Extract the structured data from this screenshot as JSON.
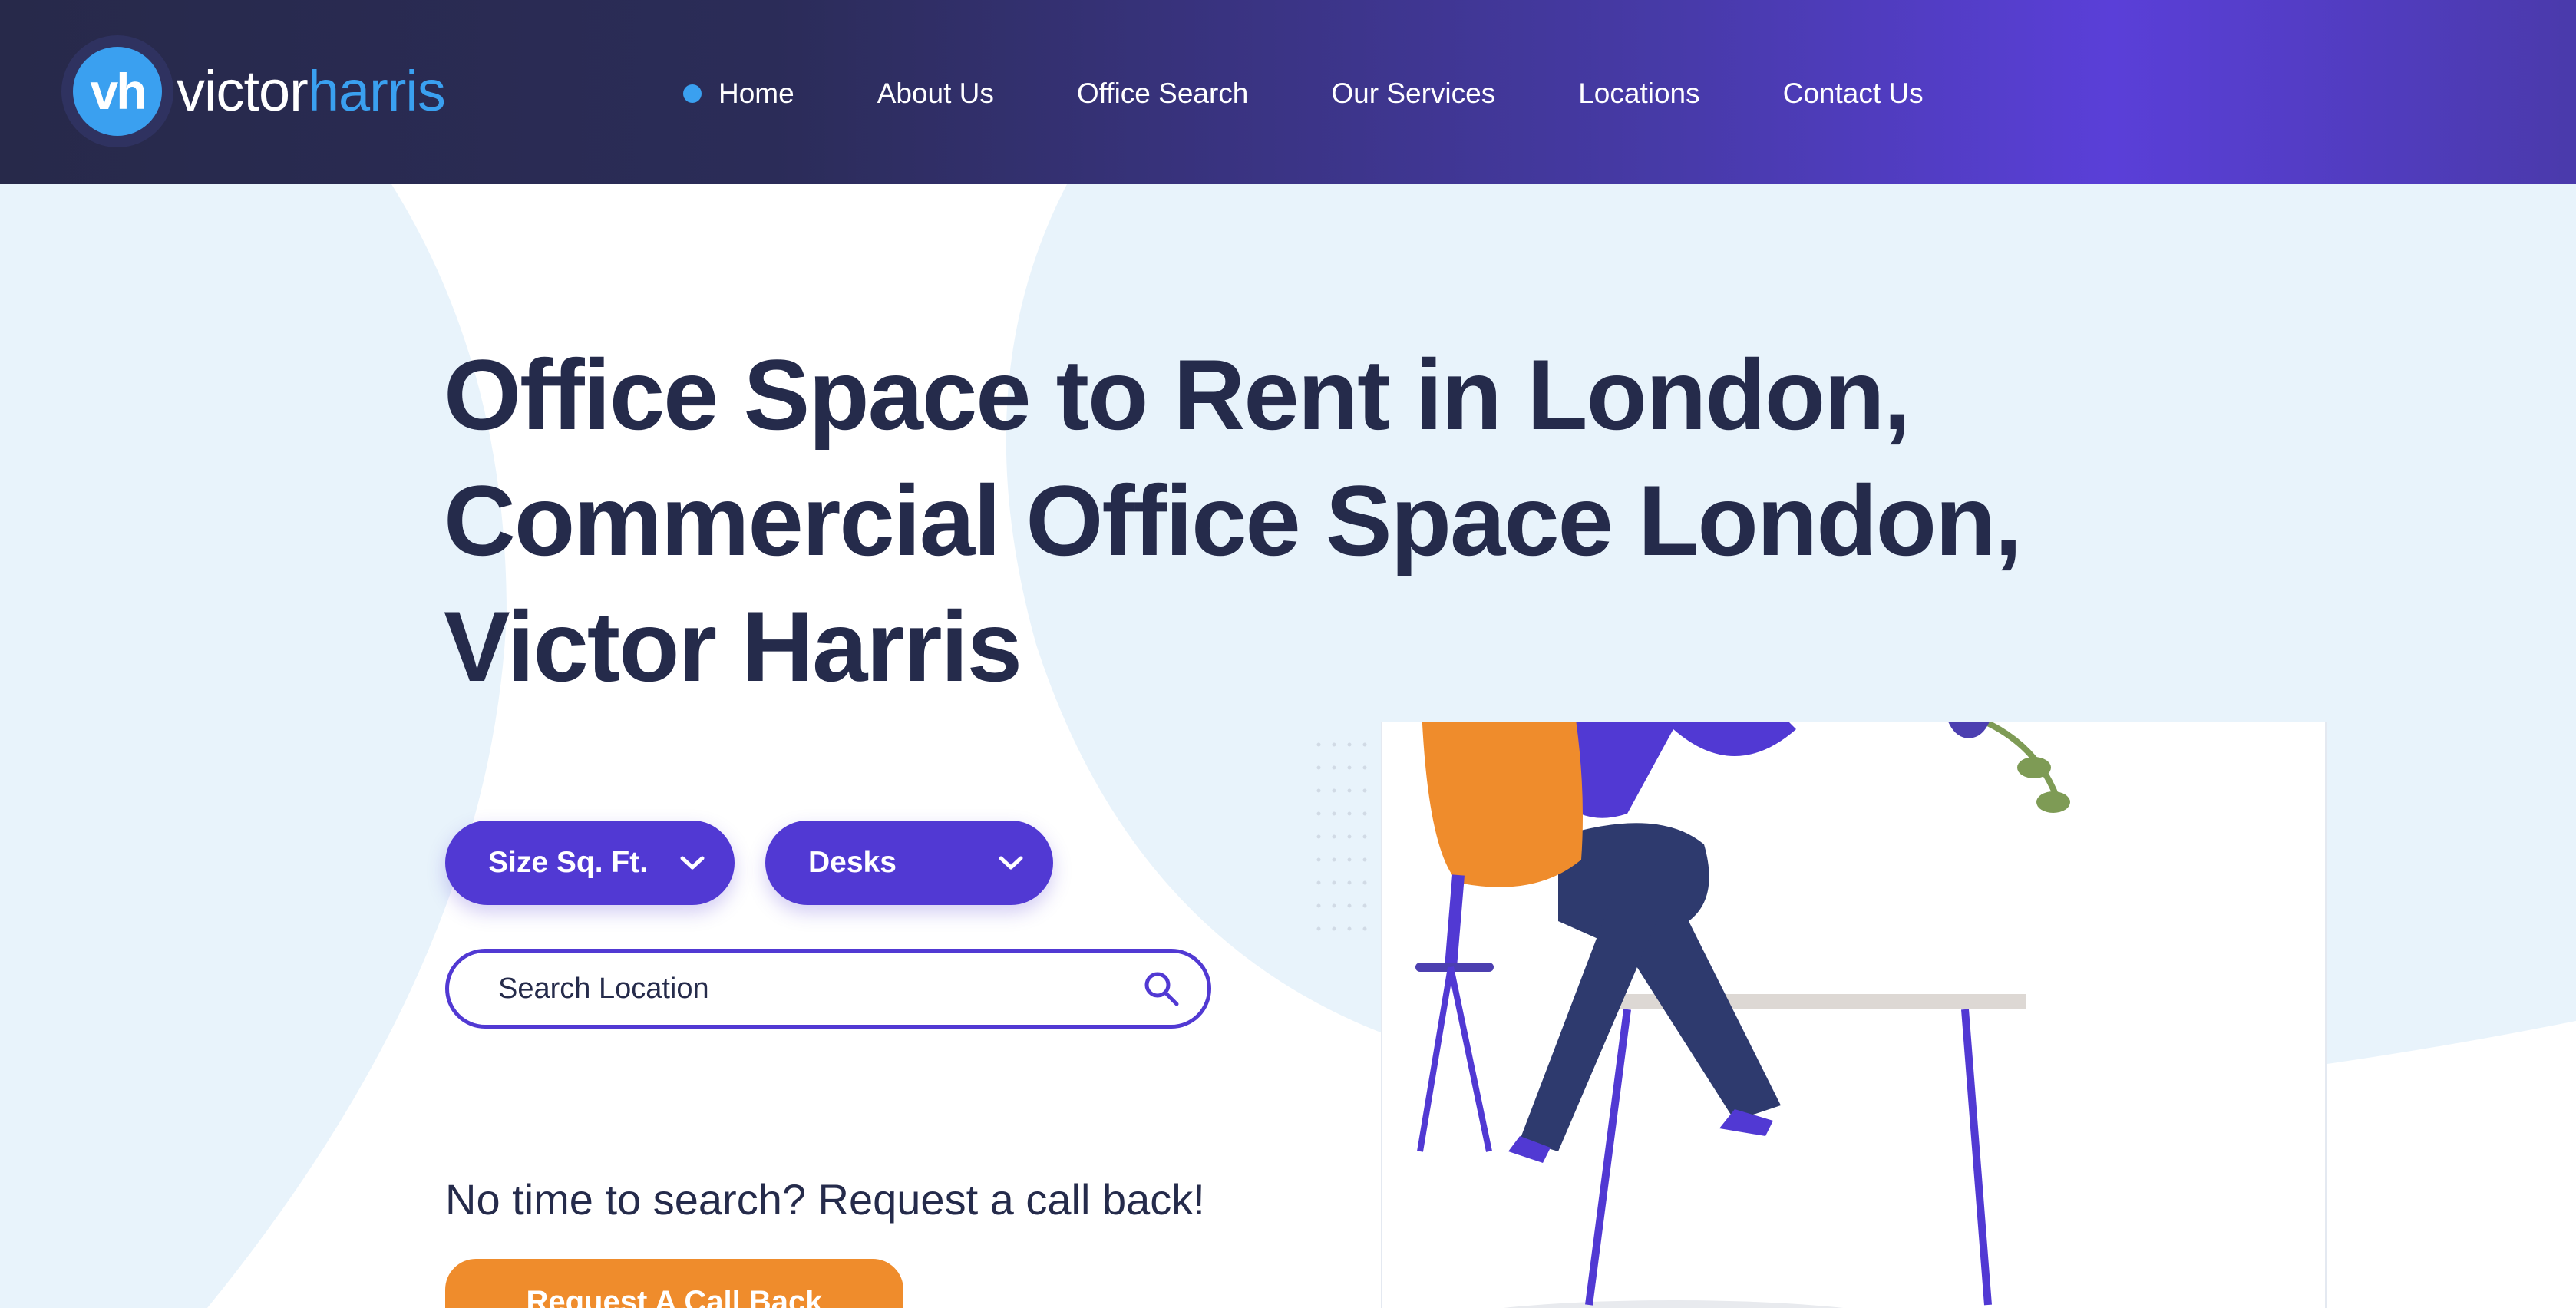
{
  "brand": {
    "mark": "vh",
    "name_part1": "victor",
    "name_part2": "harris"
  },
  "nav": {
    "items": [
      {
        "label": "Home",
        "active": true
      },
      {
        "label": "About Us"
      },
      {
        "label": "Office Search"
      },
      {
        "label": "Our Services"
      },
      {
        "label": "Locations"
      },
      {
        "label": "Contact Us"
      }
    ]
  },
  "hero": {
    "headline_lines": [
      "Office Space to Rent in London,",
      "Commercial Office Space London,",
      "Victor Harris"
    ],
    "filters": {
      "size_label": "Size Sq. Ft.",
      "desks_label": "Desks"
    },
    "search": {
      "placeholder": "Search Location"
    },
    "callback_prompt": "No time to search? Request a call back!",
    "callback_button": "Request A Call Back"
  },
  "colors": {
    "header_dark": "#27294a",
    "header_purple": "#5a3fd8",
    "accent_blue": "#3aa0f0",
    "button_purple": "#5139d3",
    "cta_orange": "#ef8c2c",
    "text_dark": "#252b4b",
    "hero_bg": "#e8f3fb"
  },
  "icons": [
    "chevron-down-icon",
    "search-icon"
  ]
}
